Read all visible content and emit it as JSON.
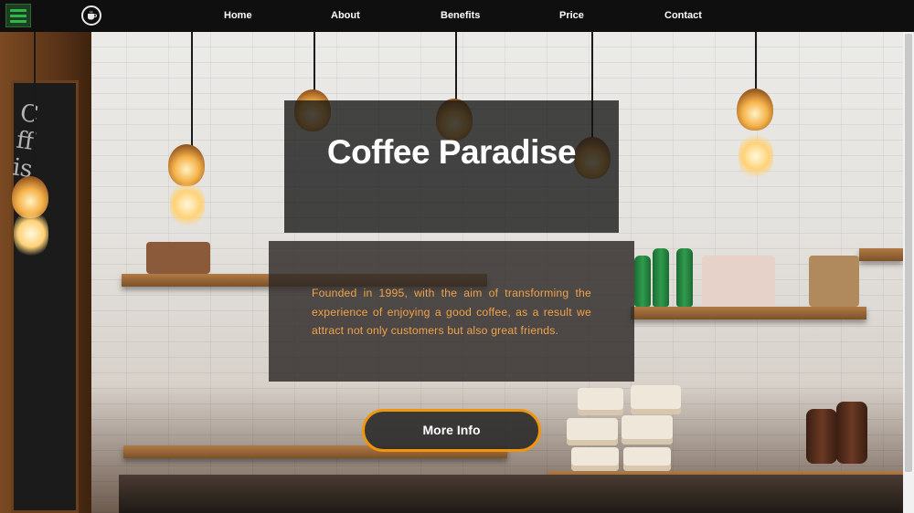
{
  "nav": {
    "items": [
      {
        "label": "Home"
      },
      {
        "label": "About"
      },
      {
        "label": "Benefits"
      },
      {
        "label": "Price"
      },
      {
        "label": "Contact"
      }
    ]
  },
  "hero": {
    "title": "Coffee Paradise",
    "description": "Founded in 1995, with the aim of transforming the experience of enjoying a good coffee, as a result we attract not only customers but also great friends.",
    "button_label": "More Info"
  },
  "colors": {
    "accent": "#f0960e",
    "description_text": "#f0a34a",
    "navbar": "#0f0f0f",
    "menu_icon": "#2fb84a"
  },
  "icons": {
    "menu": "hamburger-icon",
    "logo": "coffee-cup-icon"
  }
}
